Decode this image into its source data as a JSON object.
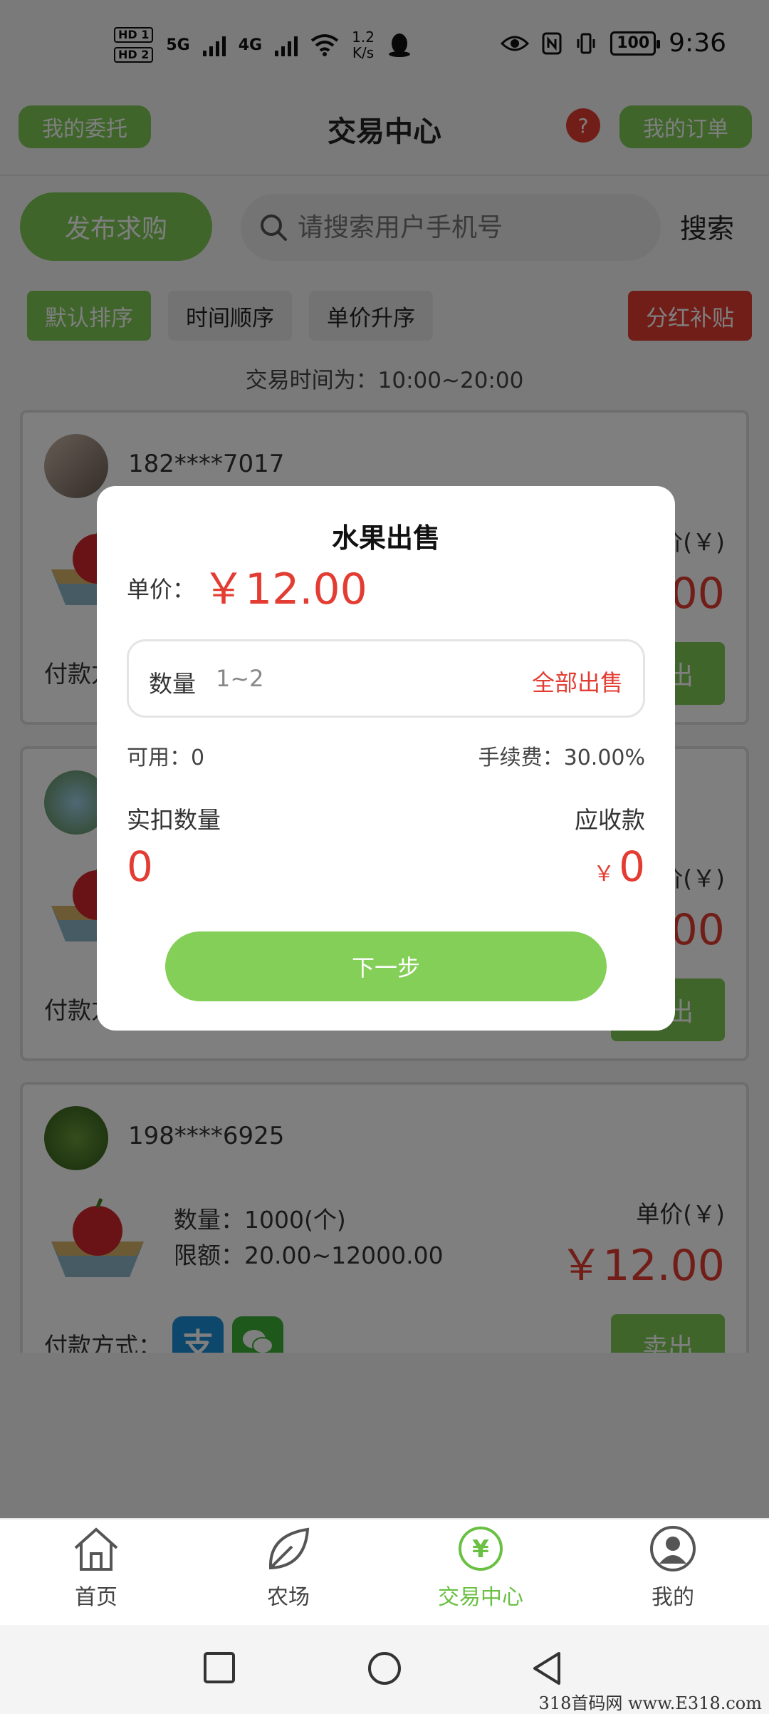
{
  "status_bar": {
    "sim1": "HD 1",
    "sim2": "HD 2",
    "net1": "5G",
    "net2": "4G",
    "speed_value": "1.2",
    "speed_unit": "K/s",
    "battery": "100",
    "time": "9:36"
  },
  "header": {
    "left_button": "我的委托",
    "title": "交易中心",
    "help": "?",
    "right_button": "我的订单"
  },
  "search": {
    "publish_button": "发布求购",
    "placeholder": "请搜索用户手机号",
    "search_button": "搜索"
  },
  "sort": {
    "options": [
      "默认排序",
      "时间顺序",
      "单价升序"
    ],
    "bonus": "分红补贴"
  },
  "trade_time": "交易时间为：10:00~20:00",
  "listings": [
    {
      "phone": "182****7017",
      "unit_label": "单价(￥)",
      "price": "￥12.00",
      "pay_label": "付款方式：",
      "sell_label": "卖出"
    },
    {
      "phone": "",
      "unit_label": "单价(￥)",
      "price": "￥12.00",
      "pay_label": "付款方式：",
      "sell_label": "卖出"
    },
    {
      "phone": "198****6925",
      "quantity": "数量：1000(个)",
      "limit": "限额：20.00~12000.00",
      "unit_label": "单价(￥)",
      "price": "￥12.00",
      "pay_label": "付款方式：",
      "sell_label": "卖出"
    }
  ],
  "modal": {
    "title": "水果出售",
    "unit_label": "单价：",
    "price": "￥12.00",
    "quantity_label": "数量",
    "quantity_placeholder": "1~2",
    "sell_all": "全部出售",
    "available": "可用：0",
    "fee": "手续费：30.00%",
    "deduct_label": "实扣数量",
    "deduct_value": "0",
    "receive_label": "应收款",
    "receive_currency": "￥",
    "receive_value": "0",
    "next_button": "下一步"
  },
  "tabbar": {
    "tabs": [
      "首页",
      "农场",
      "交易中心",
      "我的"
    ],
    "active_tab": "交易中心",
    "trade_icon_glyph": "¥"
  },
  "watermark": "318首码网 www.E318.com",
  "colors": {
    "accent_green": "#7ecb56",
    "price_red": "#e33d33",
    "active_tab_green": "#6ac043"
  }
}
